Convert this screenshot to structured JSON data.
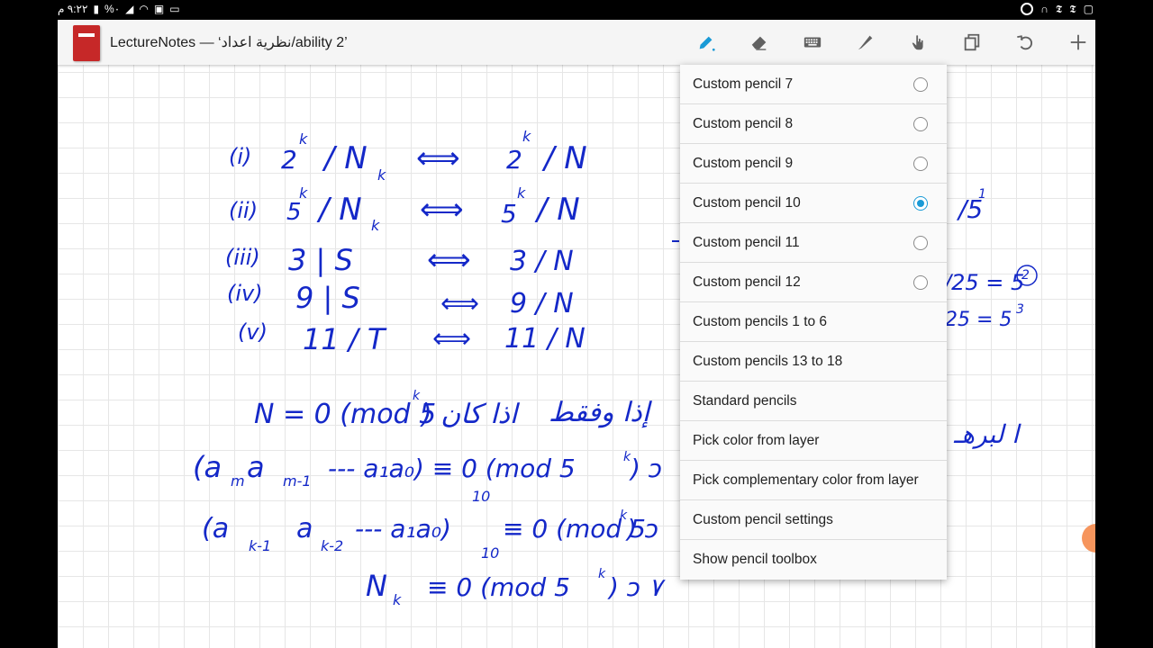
{
  "status_bar": {
    "time": "٩:٢٢ م",
    "battery": "%٠"
  },
  "app": {
    "title": "LectureNotes — ‘نظرية اعداد/ability 2’"
  },
  "toolbar": {
    "icons": [
      "pencil-icon",
      "eraser-icon",
      "keyboard-icon",
      "highlighter-icon",
      "hand-icon",
      "copy-layers-icon",
      "undo-icon",
      "add-icon"
    ]
  },
  "menu": {
    "items": [
      {
        "label": "Custom pencil 7",
        "radio": true,
        "selected": false
      },
      {
        "label": "Custom pencil 8",
        "radio": true,
        "selected": false
      },
      {
        "label": "Custom pencil 9",
        "radio": true,
        "selected": false
      },
      {
        "label": "Custom pencil 10",
        "radio": true,
        "selected": true
      },
      {
        "label": "Custom pencil 11",
        "radio": true,
        "selected": false
      },
      {
        "label": "Custom pencil 12",
        "radio": true,
        "selected": false
      },
      {
        "label": "Custom pencils 1 to 6",
        "radio": false
      },
      {
        "label": "Custom pencils 13 to 18",
        "radio": false
      },
      {
        "label": "Standard pencils",
        "radio": false
      },
      {
        "label": "Pick color from layer",
        "radio": false
      },
      {
        "label": "Pick complementary color from layer",
        "radio": false
      },
      {
        "label": "Custom pencil settings",
        "radio": false
      },
      {
        "label": "Show pencil toolbox",
        "radio": false
      }
    ]
  },
  "colors": {
    "ink": "#1428c8",
    "accent": "#1a9ad6",
    "logo": "#c62828"
  },
  "handwriting": {
    "rows": [
      {
        "label": "(i)",
        "left": "2",
        "left_exp": "k",
        "left_rest": "/ N",
        "left_sub": "k",
        "right": "2",
        "right_exp": "k",
        "right_rest": "/ N"
      },
      {
        "label": "(ii)",
        "left": "5",
        "left_exp": "k",
        "left_rest": "/ N",
        "left_sub": "k",
        "right": "5",
        "right_exp": "k",
        "right_rest": "/ N"
      },
      {
        "label": "(iii)",
        "left": "3 | S",
        "right": "3 / N"
      },
      {
        "label": "(iv)",
        "left": "9 | S",
        "right": "9 / N"
      },
      {
        "label": "(v)",
        "left": "11 / T",
        "right": "11 / N"
      }
    ],
    "arrow": "⟺",
    "eq1": "N = 0 (mod 5",
    "eq1_exp": "k",
    "eq1_rest": ") اذا كان",
    "eq1_arabic": "إذا وفقط",
    "eq2": "(a",
    "eq2_sub1": "m",
    "eq2_mid": " a",
    "eq2_sub2": "m-1",
    "eq2_rest": " --- a₁a₀) ≡ 0 (mod 5",
    "eq2_exp": "k",
    "eq2_end": ") ↄ",
    "eq2_sub_10": "10",
    "eq3": "(a",
    "eq3_sub1": "k-1",
    "eq3_mid": " a",
    "eq3_sub2": "k-2",
    "eq3_rest": " --- a₁a₀)",
    "eq3_sub_10": "10",
    "eq3_mod": "≡ 0 (mod 5",
    "eq3_exp": "k",
    "eq3_end": ") ↄ",
    "eq4": "N",
    "eq4_sub": "k",
    "eq4_rest": " ≡ 0 (mod 5",
    "eq4_exp": "k",
    "eq4_end": ") ↄ ٧",
    "right_frag1": "/5",
    "right_frag1_exp": "1",
    "right_frag2": "/25 = 5",
    "right_frag2_exp": "2",
    "right_frag3": "25 = 5",
    "right_frag3_exp": "3",
    "arabic_frag": "ا لبرهـ"
  }
}
